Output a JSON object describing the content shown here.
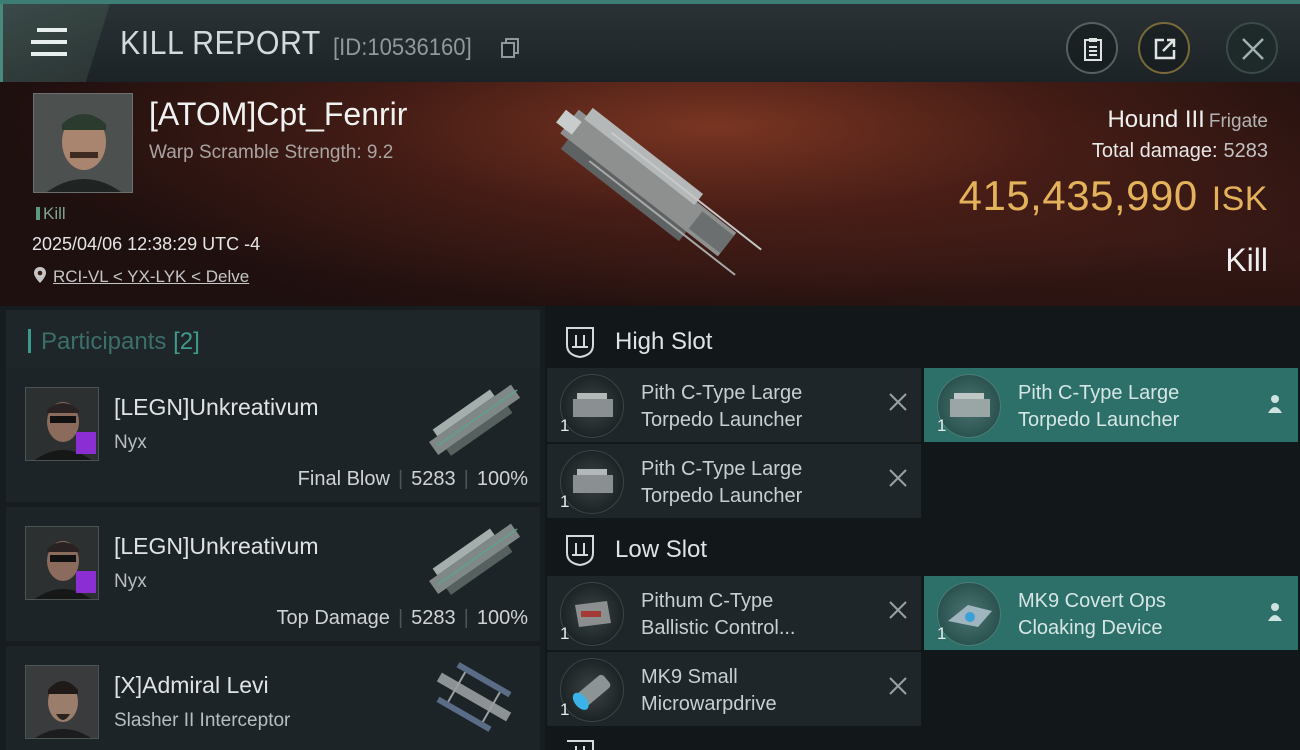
{
  "header": {
    "title": "KILL REPORT",
    "report_id": "[ID:10536160]",
    "icons": [
      "menu-icon",
      "copy-icon",
      "clipboard-icon",
      "share-icon",
      "close-icon"
    ]
  },
  "victim": {
    "name": "[ATOM]Cpt_Fenrir",
    "subtitle": "Warp Scramble Strength: 9.2",
    "tag": "Kill",
    "datetime": "2025/04/06 12:38:29 UTC -4",
    "location": "RCI-VL < YX-LYK < Delve",
    "ship_name": "Hound III",
    "ship_class": "Frigate",
    "total_damage_label": "Total damage:",
    "total_damage": "5283",
    "isk_value": "415,435,990",
    "isk_unit": "ISK",
    "result": "Kill"
  },
  "participants": {
    "label": "Participants",
    "count": "[2]",
    "rows": [
      {
        "name": "[LEGN]Unkreativum",
        "ship": "Nyx",
        "role": "Final Blow",
        "damage": "5283",
        "percent": "100%"
      },
      {
        "name": "[LEGN]Unkreativum",
        "ship": "Nyx",
        "role": "Top Damage",
        "damage": "5283",
        "percent": "100%"
      },
      {
        "name": "[X]Admiral Levi",
        "ship": "Slasher II Interceptor"
      }
    ]
  },
  "fittings": {
    "high_slot": {
      "title": "High Slot",
      "modules": [
        {
          "name_line1": "Pith C-Type Large",
          "name_line2": "Torpedo Launcher",
          "qty": "1"
        },
        {
          "name_line1": "Pith C-Type Large",
          "name_line2": "Torpedo Launcher",
          "qty": "1"
        },
        {
          "name_line1": "Pith C-Type Large",
          "name_line2": "Torpedo Launcher",
          "qty": "1"
        }
      ]
    },
    "low_slot": {
      "title": "Low Slot",
      "modules": [
        {
          "name_line1": "Pithum C-Type",
          "name_line2": "Ballistic Control...",
          "qty": "1"
        },
        {
          "name_line1": "MK9 Covert Ops",
          "name_line2": "Cloaking Device",
          "qty": "1"
        },
        {
          "name_line1": "MK9 Small",
          "name_line2": "Microwarpdrive",
          "qty": "1"
        }
      ]
    }
  },
  "colors": {
    "accent_teal": "#3d9a8a",
    "isk_gold": "#e4b25b",
    "dropped_highlight": "#2d6f69",
    "badge_purple": "#8b2fd4"
  }
}
